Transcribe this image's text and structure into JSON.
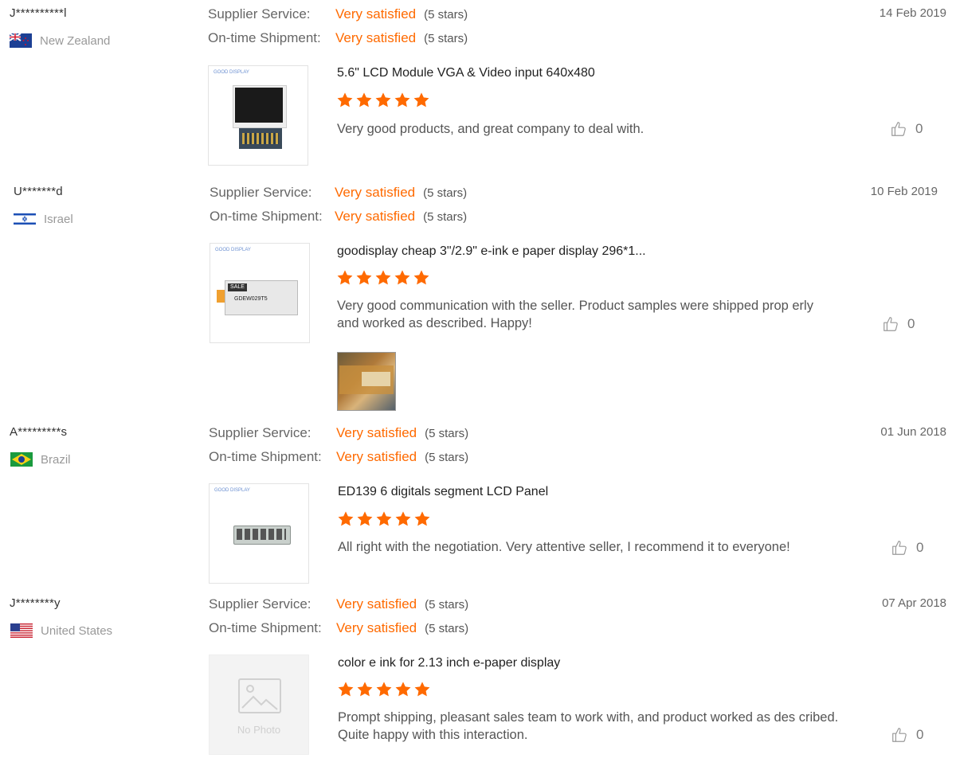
{
  "labels": {
    "supplier_service": "Supplier Service:",
    "ontime_shipment": "On-time Shipment:",
    "satisfied": "Very satisfied",
    "stars_text": "(5 stars)",
    "no_photo": "No Photo",
    "good_display_logo": "GOOD DISPLAY",
    "sale_label": "SALE",
    "epaper_label": "GDEW029T5"
  },
  "reviews": [
    {
      "buyer": "J**********l",
      "country": "New Zealand",
      "date": "14 Feb 2019",
      "product": "5.6\" LCD Module VGA & Video input 640x480",
      "comment": "Very good products, and great company to deal with.",
      "likes": "0",
      "star_count": 5
    },
    {
      "buyer": "U*******d",
      "country": "Israel",
      "date": "10 Feb 2019",
      "product": "goodisplay cheap 3\"/2.9\" e-ink e paper display 296*1...",
      "comment": "Very good communication with the seller. Product samples were shipped prop erly and worked as described. Happy!",
      "likes": "0",
      "star_count": 5
    },
    {
      "buyer": "A*********s",
      "country": "Brazil",
      "date": "01 Jun 2018",
      "product": "ED139 6 digitals segment LCD Panel",
      "comment": "All right with the negotiation. Very attentive seller, I recommend it to everyone!",
      "likes": "0",
      "star_count": 5
    },
    {
      "buyer": "J********y",
      "country": "United States",
      "date": "07 Apr 2018",
      "product": "color e ink for 2.13 inch e-paper display",
      "comment": "Prompt shipping, pleasant sales team to work with, and product worked as des cribed.  Quite happy with this interaction.",
      "likes": "0",
      "star_count": 5
    }
  ],
  "icons": {
    "star": "star-icon",
    "like": "thumbs-up-icon",
    "no_photo": "image-placeholder-icon"
  },
  "colors": {
    "accent": "#ff6a00",
    "muted": "#999999"
  }
}
